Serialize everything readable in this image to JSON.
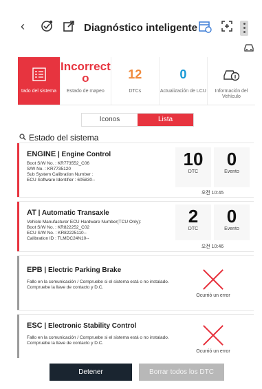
{
  "header": {
    "back_glyph": "‹",
    "title": "Diagnóstico inteligente",
    "icons": [
      "vci-badge-icon",
      "export-icon",
      "calendar-icon",
      "expand-icon",
      "more-icon",
      "car-icon"
    ]
  },
  "summary": {
    "items": [
      {
        "value": "",
        "label": "tado del sistema"
      },
      {
        "value": "Incorrect\no",
        "label": "Estado de mapeo"
      },
      {
        "value": "12",
        "label": "DTCs"
      },
      {
        "value": "0",
        "label": "Actualización de LCU"
      },
      {
        "value": "",
        "label": "Información del Vehículo"
      }
    ]
  },
  "view_toggle": {
    "iconos": "Iconos",
    "lista": "Lista"
  },
  "section_title": "Estado del sistema",
  "systems": [
    {
      "code": "ENGINE",
      "name": "Engine Control",
      "lines": [
        "Boot S/W No. : KR773552_C06",
        "S/W No. : KR7735120",
        "Sub System Calibration Number :",
        "ECU Software Identifier : 605830--"
      ],
      "dtc": "10",
      "dtc_label": "DTC",
      "evento": "0",
      "evento_label": "Evento",
      "time": "오전 10:45"
    },
    {
      "code": "AT",
      "name": "Automatic Transaxle",
      "lines": [
        "Vehicle Manufacturer ECU Hardware Number(TCU Only):",
        "Boot S/W No. : KR822252_C02",
        "ECU S/W No. : KR82225110--",
        "Calibration ID : TLMDC24N10--"
      ],
      "dtc": "2",
      "dtc_label": "DTC",
      "evento": "0",
      "evento_label": "Evento",
      "time": "오전 10:46"
    },
    {
      "code": "EPB",
      "name": "Electric Parking Brake",
      "message": "Fallo en la comunicación / Compruebe si el sistema está o no instalado. Compruebe la llave de contacto y D.C.",
      "error_label": "Ocurrió un error"
    },
    {
      "code": "ESC",
      "name": "Electronic Stability Control",
      "message": "Fallo en la comunicación / Compruebe si el sistema está o no instalado. Compruebe la llave de contacto y D.C.",
      "error_label": "Ocurrió un error"
    }
  ],
  "footer": {
    "stop": "Detener",
    "clear": "Borrar todos los DTC"
  },
  "colors": {
    "accent": "#e7343f",
    "info": "#1a9ad6",
    "orange": "#f08a3c",
    "dark": "#1a2530",
    "disabled": "#b8b8b8"
  }
}
